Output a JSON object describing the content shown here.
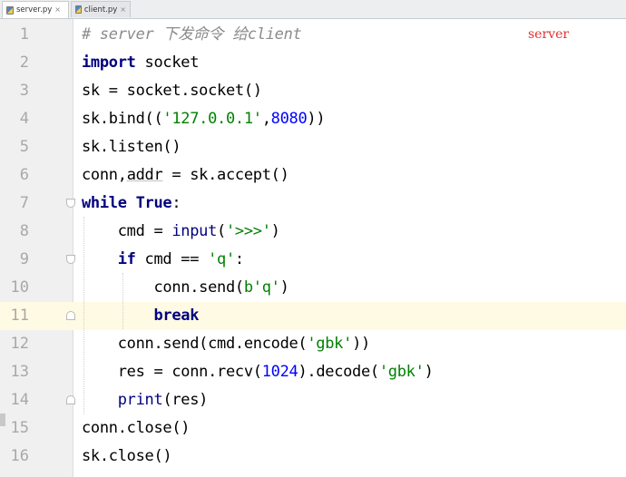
{
  "tabs": [
    {
      "label": "server.py",
      "active": true,
      "icon": "python-file-icon"
    },
    {
      "label": "client.py",
      "active": false,
      "icon": "python-file-icon"
    }
  ],
  "tab_close_glyph": "×",
  "annotation": "server",
  "current_line": 11,
  "colors": {
    "keyword": "#000080",
    "comment": "#8c8c8c",
    "string": "#008000",
    "number": "#0000ff",
    "current_line_bg": "#fffae3",
    "annotation": "#e03131"
  },
  "lines": [
    {
      "num": "1",
      "tokens": [
        {
          "t": "cm",
          "v": "# server 下发命令 给client"
        }
      ]
    },
    {
      "num": "2",
      "tokens": [
        {
          "t": "kw",
          "v": "import"
        },
        {
          "t": "",
          "v": " socket"
        }
      ]
    },
    {
      "num": "3",
      "tokens": [
        {
          "t": "",
          "v": "sk = socket.socket()"
        }
      ]
    },
    {
      "num": "4",
      "tokens": [
        {
          "t": "",
          "v": "sk.bind(("
        },
        {
          "t": "st",
          "v": "'127.0.0.1'"
        },
        {
          "t": "",
          "v": ","
        },
        {
          "t": "nm",
          "v": "8080"
        },
        {
          "t": "",
          "v": "))"
        }
      ]
    },
    {
      "num": "5",
      "tokens": [
        {
          "t": "",
          "v": "sk.listen()"
        }
      ]
    },
    {
      "num": "6",
      "tokens": [
        {
          "t": "",
          "v": "conn,"
        },
        {
          "t": "ul",
          "v": "addr"
        },
        {
          "t": "",
          "v": " = sk.accept()"
        }
      ]
    },
    {
      "num": "7",
      "tokens": [
        {
          "t": "kw",
          "v": "while"
        },
        {
          "t": "",
          "v": " "
        },
        {
          "t": "kw",
          "v": "True"
        },
        {
          "t": "",
          "v": ":"
        }
      ]
    },
    {
      "num": "8",
      "tokens": [
        {
          "t": "",
          "v": "    cmd = "
        },
        {
          "t": "bi",
          "v": "input"
        },
        {
          "t": "",
          "v": "("
        },
        {
          "t": "st",
          "v": "'>>>'"
        },
        {
          "t": "",
          "v": ")"
        }
      ]
    },
    {
      "num": "9",
      "tokens": [
        {
          "t": "",
          "v": "    "
        },
        {
          "t": "kw",
          "v": "if"
        },
        {
          "t": "",
          "v": " cmd == "
        },
        {
          "t": "st",
          "v": "'q'"
        },
        {
          "t": "",
          "v": ":"
        }
      ]
    },
    {
      "num": "10",
      "tokens": [
        {
          "t": "",
          "v": "        conn.send("
        },
        {
          "t": "st",
          "v": "b'q'"
        },
        {
          "t": "",
          "v": ")"
        }
      ]
    },
    {
      "num": "11",
      "tokens": [
        {
          "t": "",
          "v": "        "
        },
        {
          "t": "kw",
          "v": "break"
        }
      ]
    },
    {
      "num": "12",
      "tokens": [
        {
          "t": "",
          "v": "    conn.send(cmd.encode("
        },
        {
          "t": "st",
          "v": "'gbk'"
        },
        {
          "t": "",
          "v": "))"
        }
      ]
    },
    {
      "num": "13",
      "tokens": [
        {
          "t": "",
          "v": "    res = conn.recv("
        },
        {
          "t": "nm",
          "v": "1024"
        },
        {
          "t": "",
          "v": ").decode("
        },
        {
          "t": "st",
          "v": "'gbk'"
        },
        {
          "t": "",
          "v": ")"
        }
      ]
    },
    {
      "num": "14",
      "tokens": [
        {
          "t": "",
          "v": "    "
        },
        {
          "t": "bi",
          "v": "print"
        },
        {
          "t": "",
          "v": "(res)"
        }
      ]
    },
    {
      "num": "15",
      "tokens": [
        {
          "t": "",
          "v": "conn.close()"
        }
      ]
    },
    {
      "num": "16",
      "tokens": [
        {
          "t": "",
          "v": "sk.close()"
        }
      ]
    }
  ]
}
